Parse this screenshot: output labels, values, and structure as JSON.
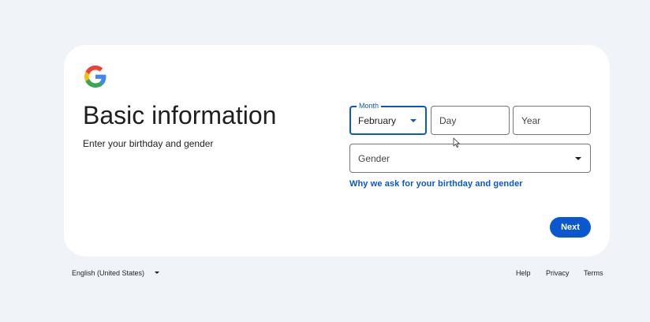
{
  "brand": {
    "logo_icon": "google-g-icon",
    "colors": {
      "blue": "#4285F4",
      "red": "#EA4335",
      "yellow": "#FBBC05",
      "green": "#34A853",
      "accent": "#0b57d0"
    }
  },
  "header": {
    "title": "Basic information",
    "subtitle": "Enter your birthday and gender"
  },
  "form": {
    "month": {
      "label": "Month",
      "value": "February",
      "icon": "dropdown-arrow-icon"
    },
    "day": {
      "placeholder": "Day"
    },
    "year": {
      "placeholder": "Year"
    },
    "gender": {
      "placeholder": "Gender",
      "icon": "dropdown-arrow-icon"
    },
    "why_link": "Why we ask for your birthday and gender",
    "next_label": "Next"
  },
  "footer": {
    "language": "English (United States)",
    "language_icon": "dropdown-arrow-icon",
    "links": [
      "Help",
      "Privacy",
      "Terms"
    ]
  }
}
